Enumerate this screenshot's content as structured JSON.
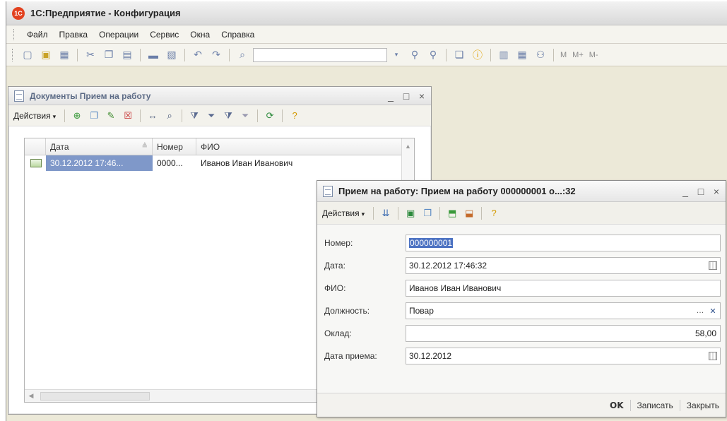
{
  "app": {
    "title": "1С:Предприятие - Конфигурация",
    "logo": "1С"
  },
  "menu": {
    "items": [
      "Файл",
      "Правка",
      "Операции",
      "Сервис",
      "Окна",
      "Справка"
    ]
  },
  "toolbar": {
    "memory_labels": [
      "M",
      "M+",
      "M-"
    ]
  },
  "list_window": {
    "title": "Документы Прием на работу",
    "actions_label": "Действия",
    "columns": [
      "Дата",
      "Номер",
      "ФИО"
    ],
    "rows": [
      {
        "date": "30.12.2012 17:46...",
        "number": "0000...",
        "fio": "Иванов Иван Иванович"
      }
    ]
  },
  "form_window": {
    "title": "Прием на работу: Прием на работу 000000001 о...:32",
    "actions_label": "Действия",
    "fields": {
      "number": {
        "label": "Номер:",
        "value": "000000001"
      },
      "date": {
        "label": "Дата:",
        "value": "30.12.2012 17:46:32"
      },
      "fio": {
        "label": "ФИО:",
        "value": "Иванов Иван Иванович"
      },
      "position": {
        "label": "Должность:",
        "value": "Повар"
      },
      "salary": {
        "label": "Оклад:",
        "value": "58,00"
      },
      "hire_date": {
        "label": "Дата приема:",
        "value": "30.12.2012"
      }
    },
    "buttons": {
      "ok": "OK",
      "save": "Записать",
      "close": "Закрыть"
    }
  },
  "window_controls": {
    "minimize": "_",
    "maximize": "□",
    "close": "×"
  },
  "colors": {
    "selection": "#7f98c9",
    "accent": "#e2411f"
  }
}
